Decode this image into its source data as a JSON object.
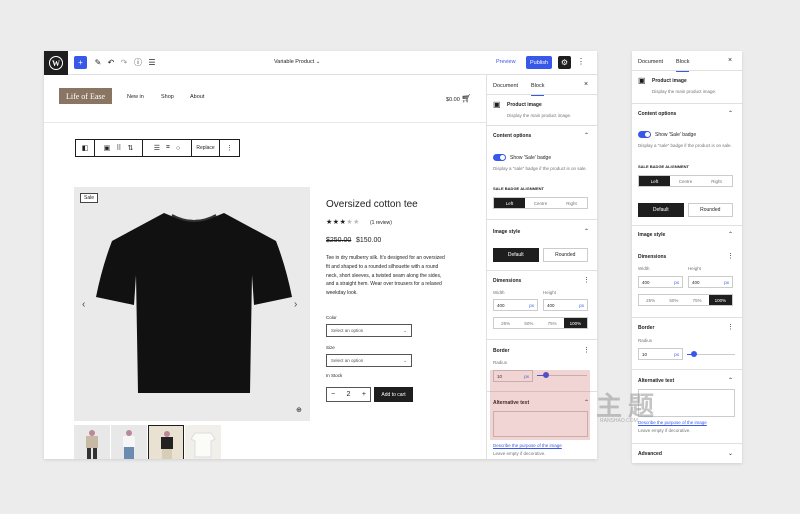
{
  "editor": {
    "doc_title": "Variable Product",
    "preview_label": "Preview",
    "publish_label": "Publish"
  },
  "site": {
    "logo": "Life of Ease",
    "nav": [
      "New in",
      "Shop",
      "About"
    ],
    "cart": "$0.00"
  },
  "block_toolbar": {
    "replace_label": "Replace"
  },
  "product": {
    "sale_badge": "Sale",
    "title": "Oversized cotton tee",
    "rating": 3,
    "reviews": "(1 review)",
    "old_price": "$250.00",
    "new_price": "$150.00",
    "description": "Tee in dry mulberry silk. It's designed for an oversized fit and shaped to a rounded silhouette with a round neck, short sleeves, a twisted seam along the sides, and a straight hem. Wear over trousers for a relaxed weekday look.",
    "color_label": "Color",
    "color_placeholder": "Select an option",
    "size_label": "Size",
    "size_placeholder": "Select an option",
    "stock": "In Stock",
    "qty": "2",
    "add_to_cart": "Add to cart"
  },
  "sidebar": {
    "tab_document": "Document",
    "tab_block": "Block",
    "block_name": "Product image",
    "block_desc": "Display the main product image.",
    "content_options": "Content options",
    "show_sale": "Show 'Sale' badge",
    "show_sale_help": "Display a \"sale\" badge if the product is on sale.",
    "badge_alignment": "SALE BADGE ALIGNMENT",
    "align_options": [
      "Left",
      "Centre",
      "Right"
    ],
    "image_style": "Image style",
    "style_options": [
      "Default",
      "Rounded"
    ],
    "dimensions": "Dimensions",
    "width_label": "Width",
    "height_label": "Height",
    "width_value": "400",
    "height_value": "400",
    "unit": "px",
    "percent_options": [
      "25%",
      "50%",
      "75%",
      "100%"
    ],
    "border": "Border",
    "radius_label": "Radius",
    "radius_value": "10",
    "alt_text": "Alternative text",
    "alt_link": "Describe the purpose of the image",
    "alt_help": "Leave empty if decorative.",
    "advanced": "Advanced"
  },
  "watermark": {
    "text": "主题",
    "url": "RANSHAO.COM"
  },
  "colors": {
    "accent": "#3858e9",
    "dark": "#1e1e1e",
    "logo_bg": "#8a7563"
  }
}
